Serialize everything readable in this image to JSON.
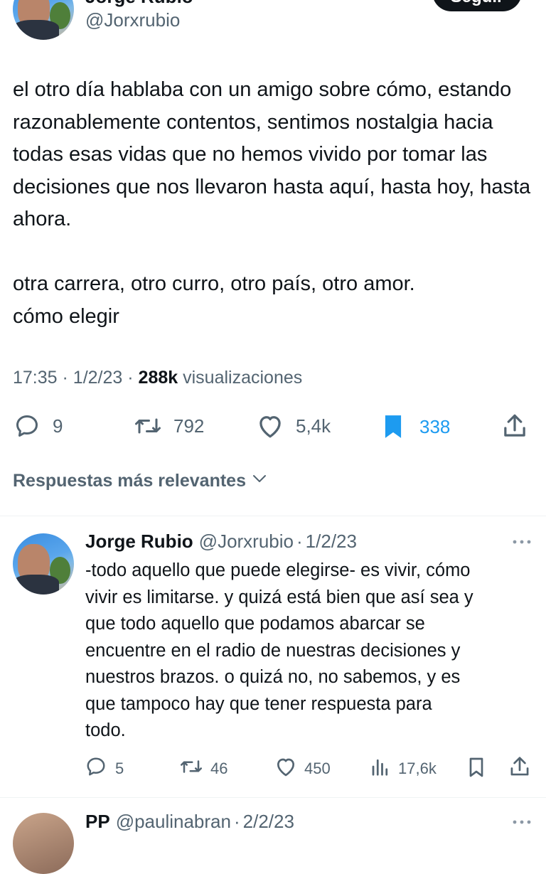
{
  "tweet": {
    "author_name": "Jorge Rubio",
    "handle": "@Jorxrubio",
    "follow_label": "Seguir",
    "text": "el otro día hablaba con un amigo sobre cómo, estando razonablemente contentos, sentimos nostalgia hacia todas esas vidas que no hemos vivido por tomar las decisiones que nos llevaron hasta aquí, hasta hoy, hasta ahora.\n\notra carrera, otro curro, otro país, otro amor.\ncómo elegir",
    "time": "17:35",
    "date": "1/2/23",
    "views": "288k",
    "views_label": "visualizaciones",
    "replies": "9",
    "retweets": "792",
    "likes": "5,4k",
    "bookmarks": "338",
    "accent_color": "#1d9bf0"
  },
  "sort": {
    "label": "Respuestas más relevantes"
  },
  "reply": {
    "author_name": "Jorge Rubio",
    "handle": "@Jorxrubio",
    "date": "1/2/23",
    "text": "-todo aquello que puede elegirse- es vivir, cómo\nvivir es limitarse. y quizá está bien que así sea y\nque todo aquello que podamos abarcar se\nencuentre en el radio de nuestras decisiones y\nnuestros brazos. o quizá no, no sabemos, y es\nque tampoco hay que tener respuesta para\ntodo.",
    "replies": "5",
    "retweets": "46",
    "likes": "450",
    "views": "17,6k"
  },
  "next_reply": {
    "author_name": "PP",
    "handle": "@paulinabran",
    "date": "2/2/23"
  }
}
